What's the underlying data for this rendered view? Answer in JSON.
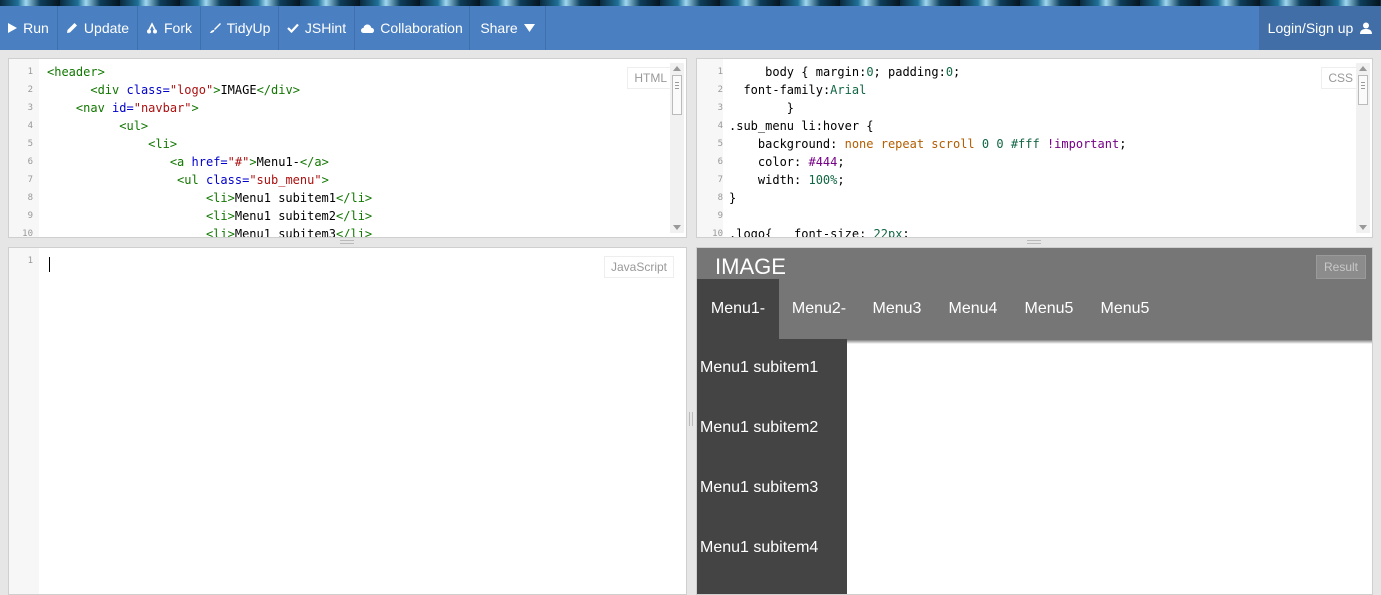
{
  "toolbar": {
    "run": "Run",
    "update": "Update",
    "fork": "Fork",
    "tidyup": "TidyUp",
    "jshint": "JSHint",
    "collaboration": "Collaboration",
    "share": "Share",
    "login": "Login/Sign up"
  },
  "html_panel": {
    "label": "HTML",
    "lines": [
      {
        "n": "1",
        "code": "<header>"
      },
      {
        "n": "2",
        "code": "      <div class=\"logo\">IMAGE</div>"
      },
      {
        "n": "3",
        "code": "    <nav id=\"navbar\">"
      },
      {
        "n": "4",
        "code": "          <ul>"
      },
      {
        "n": "5",
        "code": "              <li>"
      },
      {
        "n": "6",
        "code": "                 <a href=\"#\">Menu1-</a>"
      },
      {
        "n": "7",
        "code": "                  <ul class=\"sub_menu\">"
      },
      {
        "n": "8",
        "code": "                      <li>Menu1 subitem1</li>"
      },
      {
        "n": "9",
        "code": "                      <li>Menu1 subitem2</li>"
      },
      {
        "n": "10",
        "code": "                      <li>Menu1 subitem3</li>"
      }
    ]
  },
  "css_panel": {
    "label": "CSS",
    "lines": [
      {
        "n": "1",
        "code": "     body { margin:0; padding:0;"
      },
      {
        "n": "2",
        "code": "  font-family:Arial"
      },
      {
        "n": "3",
        "code": "        }"
      },
      {
        "n": "4",
        "code": ".sub_menu li:hover {"
      },
      {
        "n": "5",
        "code": "    background: none repeat scroll 0 0 #fff !important;"
      },
      {
        "n": "6",
        "code": "    color: #444;"
      },
      {
        "n": "7",
        "code": "    width: 100%;"
      },
      {
        "n": "8",
        "code": "}"
      },
      {
        "n": "9",
        "code": ""
      },
      {
        "n": "10",
        "code": ".logo{   font-size: 22px;"
      }
    ]
  },
  "js_panel": {
    "label": "JavaScript",
    "lines": [
      {
        "n": "1",
        "code": ""
      }
    ]
  },
  "result_panel": {
    "label": "Result",
    "logo": "IMAGE",
    "nav": [
      "Menu1-",
      "Menu2-",
      "Menu3",
      "Menu4",
      "Menu5",
      "Menu5"
    ],
    "submenu": [
      "Menu1 subitem1",
      "Menu1 subitem2",
      "Menu1 subitem3",
      "Menu1 subitem4"
    ]
  },
  "colors": {
    "toolbar_bg": "#4a7fc1",
    "result_header": "#767676",
    "submenu_bg": "#444444"
  }
}
